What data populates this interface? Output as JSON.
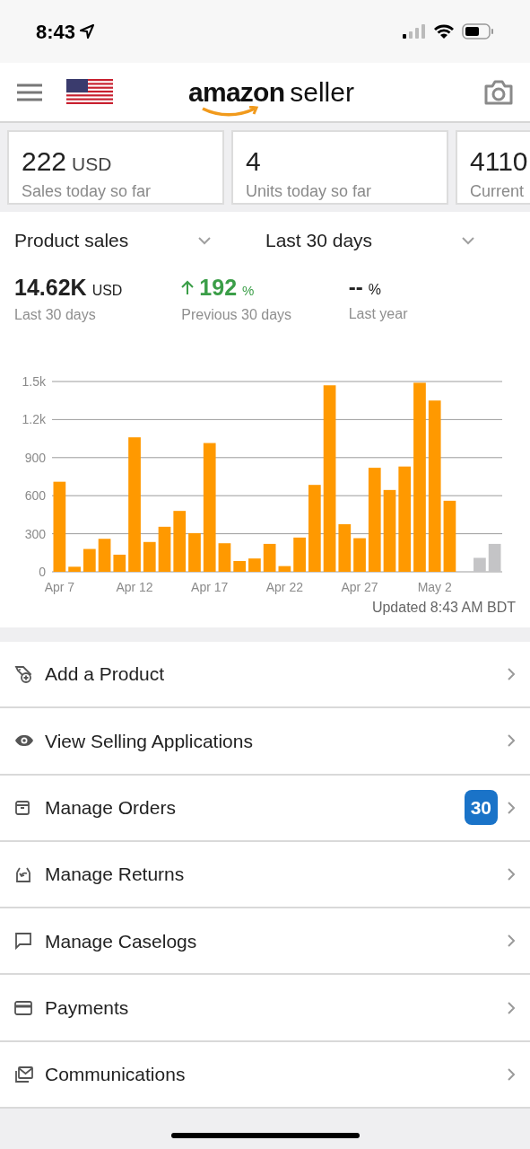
{
  "status_bar": {
    "time": "8:43"
  },
  "header": {
    "logo_bold": "amazon",
    "logo_light": "seller"
  },
  "summary_cards": [
    {
      "value": "222",
      "unit": "USD",
      "label": "Sales today so far"
    },
    {
      "value": "4",
      "label": "Units today so far"
    },
    {
      "value": "4110",
      "label": "Current"
    }
  ],
  "selectors": [
    {
      "label": "Product sales"
    },
    {
      "label": "Last 30 days"
    }
  ],
  "metrics": [
    {
      "kind": "total",
      "value": "14.62K",
      "unit": "USD",
      "label": "Last 30 days"
    },
    {
      "kind": "change",
      "value": "192",
      "unit": "%",
      "label": "Previous 30 days"
    },
    {
      "kind": "empty",
      "value": "--",
      "unit": "%",
      "label": "Last year"
    }
  ],
  "chart_data": {
    "type": "bar",
    "categories": [
      "Apr 7",
      null,
      null,
      null,
      null,
      "Apr 12",
      null,
      null,
      null,
      null,
      "Apr 17",
      null,
      null,
      null,
      null,
      "Apr 22",
      null,
      null,
      null,
      null,
      "Apr 27",
      null,
      null,
      null,
      null,
      "May 2",
      null,
      null,
      null,
      null
    ],
    "yticks": [
      0,
      300,
      {
        "value": 600,
        "label": "600"
      },
      {
        "value": 900,
        "label": "900"
      },
      {
        "value": 1200,
        "label": "1.2k"
      },
      {
        "value": 1500,
        "label": "1.5k"
      }
    ],
    "ylim": [
      0,
      1500
    ],
    "grid": true,
    "series": [
      {
        "color": "#ff9900",
        "values": [
          710,
          40,
          180,
          260,
          135,
          1060,
          235,
          355,
          480,
          305,
          1015,
          225,
          85,
          105,
          220,
          45,
          270,
          685,
          1470,
          375,
          265,
          820,
          645,
          830,
          1490,
          1350,
          560,
          null,
          null,
          null
        ]
      },
      {
        "color": "#c4c4c6",
        "values": [
          null,
          null,
          null,
          null,
          null,
          null,
          null,
          null,
          null,
          null,
          null,
          null,
          null,
          null,
          null,
          null,
          null,
          null,
          null,
          null,
          null,
          null,
          null,
          null,
          null,
          null,
          null,
          null,
          110,
          220
        ]
      }
    ]
  },
  "updated": "Updated 8:43 AM BDT",
  "menu": [
    {
      "kind": "tag",
      "label": "Add a Product"
    },
    {
      "kind": "eye",
      "label": "View Selling Applications"
    },
    {
      "kind": "box",
      "label": "Manage Orders",
      "badge": "30"
    },
    {
      "kind": "return",
      "label": "Manage Returns"
    },
    {
      "kind": "chat",
      "label": "Manage Caselogs"
    },
    {
      "kind": "card",
      "label": "Payments"
    },
    {
      "kind": "mail",
      "label": "Communications"
    }
  ]
}
